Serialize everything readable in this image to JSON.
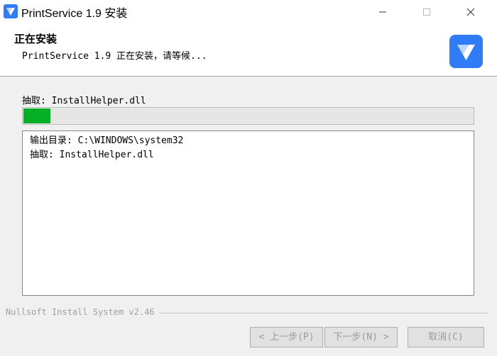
{
  "window": {
    "title": "PrintService 1.9 安装",
    "icons": {
      "app": "shield-app-icon",
      "minimize": "minimize-icon",
      "maximize": "maximize-icon",
      "close": "close-icon"
    }
  },
  "header": {
    "title": "正在安装",
    "subtitle": "PrintService 1.9 正在安装，请等候...",
    "logo_icon": "shield-logo-icon"
  },
  "status": {
    "text": "抽取: InstallHelper.dll",
    "progress_fraction": 0.06
  },
  "log": {
    "lines": [
      "输出目录: C:\\WINDOWS\\system32",
      "抽取: InstallHelper.dll"
    ]
  },
  "footer": {
    "branding": "Nullsoft Install System v2.46",
    "buttons": {
      "back": "< 上一步(P)",
      "next": "下一步(N) >",
      "cancel": "取消(C)"
    }
  },
  "colors": {
    "accent": "#2f7cf6",
    "progress": "#06b025",
    "disabled_text": "#9a9a9a"
  }
}
